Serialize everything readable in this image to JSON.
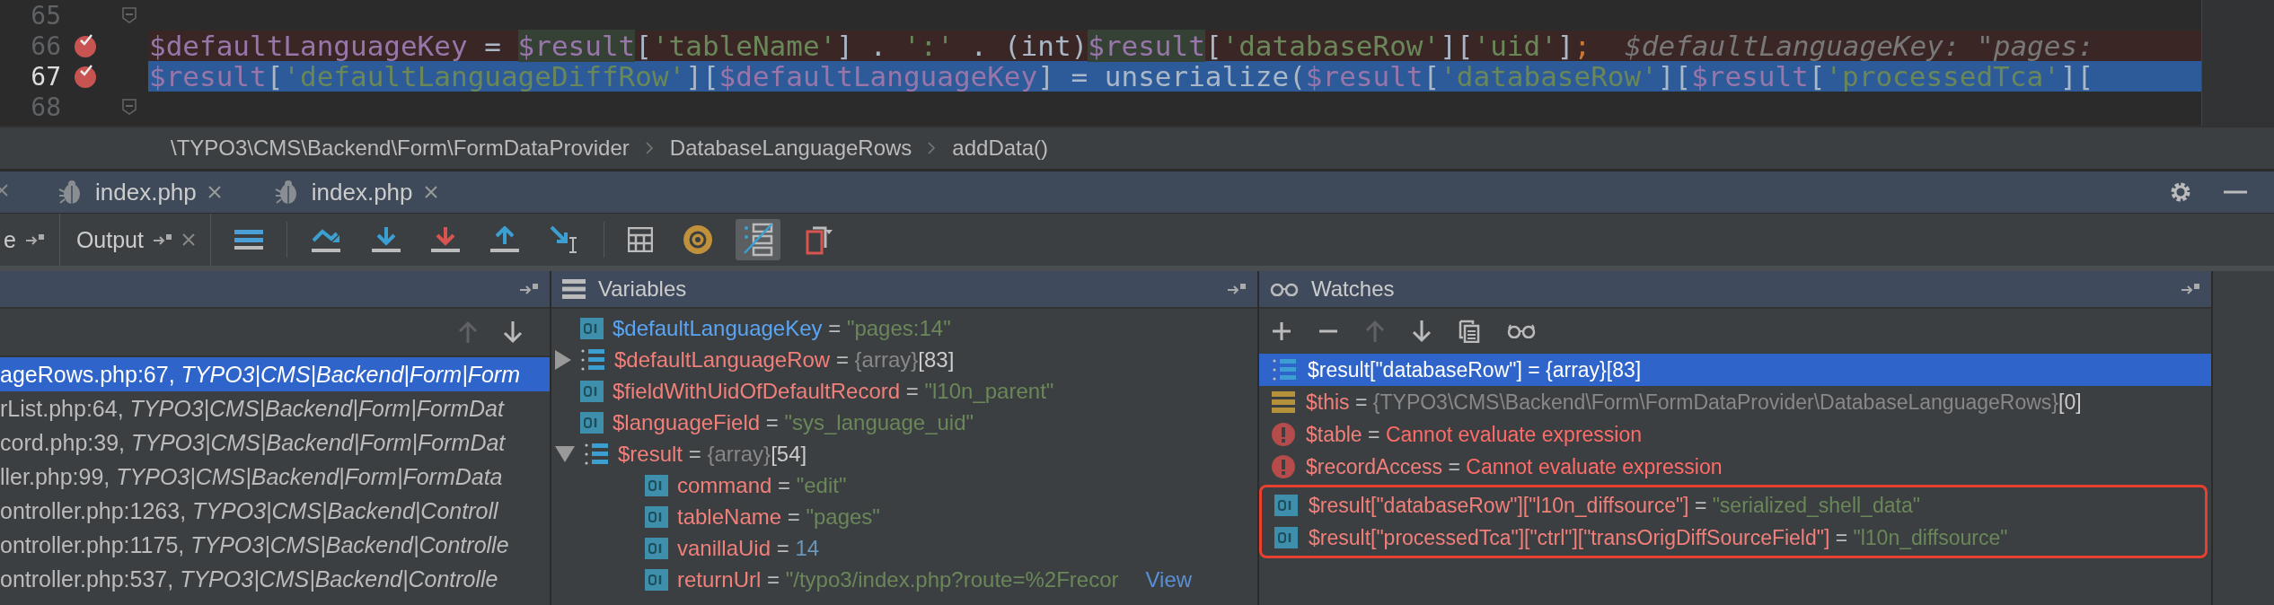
{
  "editor": {
    "lines": [
      {
        "number": "65",
        "breakpoint": false,
        "kind": "plain",
        "fold": true
      },
      {
        "number": "66",
        "breakpoint": true,
        "kind": "breakpoint",
        "fold": false,
        "tokens": [
          {
            "kind": "var",
            "text": "$defaultLanguageKey"
          },
          {
            "kind": "plain",
            "text": " = "
          },
          {
            "kind": "usage",
            "text": "$result"
          },
          {
            "kind": "plain",
            "text": "["
          },
          {
            "kind": "str",
            "text": "'tableName'"
          },
          {
            "kind": "plain",
            "text": "] . "
          },
          {
            "kind": "str",
            "text": "':'"
          },
          {
            "kind": "plain",
            "text": " . (int)"
          },
          {
            "kind": "usage",
            "text": "$result"
          },
          {
            "kind": "plain",
            "text": "["
          },
          {
            "kind": "str",
            "text": "'databaseRow'"
          },
          {
            "kind": "plain",
            "text": "]["
          },
          {
            "kind": "str",
            "text": "'uid'"
          },
          {
            "kind": "plain",
            "text": "]"
          },
          {
            "kind": "op",
            "text": ";"
          },
          {
            "kind": "hint",
            "text": "$defaultLanguageKey: \"pages:"
          }
        ]
      },
      {
        "number": "67",
        "breakpoint": true,
        "kind": "current",
        "fold": false,
        "tokens": [
          {
            "kind": "var",
            "text": "$result"
          },
          {
            "kind": "plain",
            "text": "["
          },
          {
            "kind": "str",
            "text": "'defaultLanguageDiffRow'"
          },
          {
            "kind": "plain",
            "text": "]["
          },
          {
            "kind": "var",
            "text": "$defaultLanguageKey"
          },
          {
            "kind": "plain",
            "text": "] = unserialize("
          },
          {
            "kind": "var",
            "text": "$result"
          },
          {
            "kind": "plain",
            "text": "["
          },
          {
            "kind": "str",
            "text": "'databaseRow'"
          },
          {
            "kind": "plain",
            "text": "]["
          },
          {
            "kind": "var",
            "text": "$result"
          },
          {
            "kind": "plain",
            "text": "["
          },
          {
            "kind": "str",
            "text": "'processedTca'"
          },
          {
            "kind": "plain",
            "text": "]["
          }
        ]
      },
      {
        "number": "68",
        "breakpoint": false,
        "kind": "plain",
        "fold": true
      }
    ]
  },
  "breadcrumb": [
    "\\TYPO3\\CMS\\Backend\\Form\\FormDataProvider",
    "DatabaseLanguageRows",
    "addData()"
  ],
  "session_tabs": [
    {
      "label": "index.php"
    },
    {
      "label": "index.php"
    }
  ],
  "tool_tabs": [
    {
      "label": "e",
      "closable": false
    },
    {
      "label": "Output",
      "closable": true
    }
  ],
  "toolbar": [
    {
      "kind": "frames",
      "selected": false
    },
    {
      "kind": "step-over",
      "selected": false
    },
    {
      "kind": "step-into",
      "selected": false
    },
    {
      "kind": "force-step-into",
      "selected": false
    },
    {
      "kind": "step-out",
      "selected": false
    },
    {
      "kind": "run-to-cursor",
      "selected": false
    },
    {
      "kind": "evaluate",
      "selected": false
    },
    {
      "kind": "at",
      "selected": false
    },
    {
      "kind": "numbered",
      "selected": true
    },
    {
      "kind": "clipboard",
      "selected": false
    }
  ],
  "frames": {
    "toolbar": [
      {
        "kind": "up",
        "disabled": true
      },
      {
        "kind": "down",
        "disabled": false
      }
    ],
    "items": [
      {
        "text": "ageRows.php:67, *TYPO3|CMS|Backend|Form|Form*",
        "selected": true
      },
      {
        "text": "rList.php:64, *TYPO3|CMS|Backend|Form|FormDat*",
        "selected": false
      },
      {
        "text": "cord.php:39, *TYPO3|CMS|Backend|Form|FormDat*",
        "selected": false
      },
      {
        "text": "ller.php:99, *TYPO3|CMS|Backend|Form|FormData*",
        "selected": false
      },
      {
        "text": "ontroller.php:1263, *TYPO3|CMS|Backend|Controll*",
        "selected": false
      },
      {
        "text": "ontroller.php:1175, *TYPO3|CMS|Backend|Controlle*",
        "selected": false
      },
      {
        "text": "ontroller.php:537, *TYPO3|CMS|Backend|Controlle*",
        "selected": false
      }
    ]
  },
  "variables": {
    "title": "Variables",
    "items": [
      {
        "kind": "string",
        "name": "$defaultLanguageKey",
        "sep": "=",
        "value": "\"pages:14\"",
        "changed": true
      },
      {
        "kind": "array",
        "name": "$defaultLanguageRow",
        "sep": "=",
        "value": "{array}",
        "count": "[83]",
        "expanded": false,
        "changed": false
      },
      {
        "kind": "string",
        "name": "$fieldWithUidOfDefaultRecord",
        "sep": "=",
        "value": "\"l10n_parent\"",
        "changed": false
      },
      {
        "kind": "string",
        "name": "$languageField",
        "sep": "=",
        "value": "\"sys_language_uid\"",
        "changed": false
      },
      {
        "kind": "array",
        "name": "$result",
        "sep": "=",
        "value": "{array}",
        "count": "[54]",
        "expanded": true,
        "changed": false,
        "children": [
          {
            "kind": "string",
            "name": "command",
            "sep": "=",
            "value": "\"edit\"",
            "changed": false
          },
          {
            "kind": "string",
            "name": "tableName",
            "sep": "=",
            "value": "\"pages\"",
            "changed": false
          },
          {
            "kind": "number",
            "name": "vanillaUid",
            "sep": "=",
            "value": "14",
            "changed": false
          },
          {
            "kind": "string",
            "name": "returnUrl",
            "sep": "=",
            "value": "\"/typo3/index.php?route=%2Frecor",
            "changed": false,
            "link": "View"
          }
        ]
      }
    ]
  },
  "watches": {
    "title": "Watches",
    "toolbar": [
      {
        "kind": "plus",
        "disabled": false
      },
      {
        "kind": "minus",
        "disabled": false
      },
      {
        "kind": "up",
        "disabled": true
      },
      {
        "kind": "down",
        "disabled": false
      },
      {
        "kind": "copy",
        "disabled": false
      },
      {
        "kind": "glasses",
        "disabled": false
      }
    ],
    "items": [
      {
        "kind": "array",
        "name": "$result[\"databaseRow\"]",
        "sep": "=",
        "value": "{array}",
        "count": "[83]",
        "selected": true,
        "boxed": false
      },
      {
        "kind": "object",
        "name": "$this",
        "sep": "=",
        "value": "{TYPO3\\CMS\\Backend\\Form\\FormDataProvider\\DatabaseLanguageRows}",
        "count": "[0]",
        "selected": false,
        "boxed": false
      },
      {
        "kind": "error",
        "name": "$table",
        "sep": "=",
        "value": "Cannot evaluate expression",
        "selected": false,
        "boxed": false
      },
      {
        "kind": "error",
        "name": "$recordAccess",
        "sep": "=",
        "value": "Cannot evaluate expression",
        "selected": false,
        "boxed": false
      },
      {
        "kind": "scalar",
        "name": "$result[\"databaseRow\"][\"l10n_diffsource\"]",
        "sep": "=",
        "value": "\"serialized_shell_data\"",
        "selected": false,
        "boxed": true
      },
      {
        "kind": "scalar",
        "name": "$result[\"processedTca\"][\"ctrl\"][\"transOrigDiffSourceField\"]",
        "sep": "=",
        "value": "\"l10n_diffsource\"",
        "selected": false,
        "boxed": true
      }
    ]
  }
}
